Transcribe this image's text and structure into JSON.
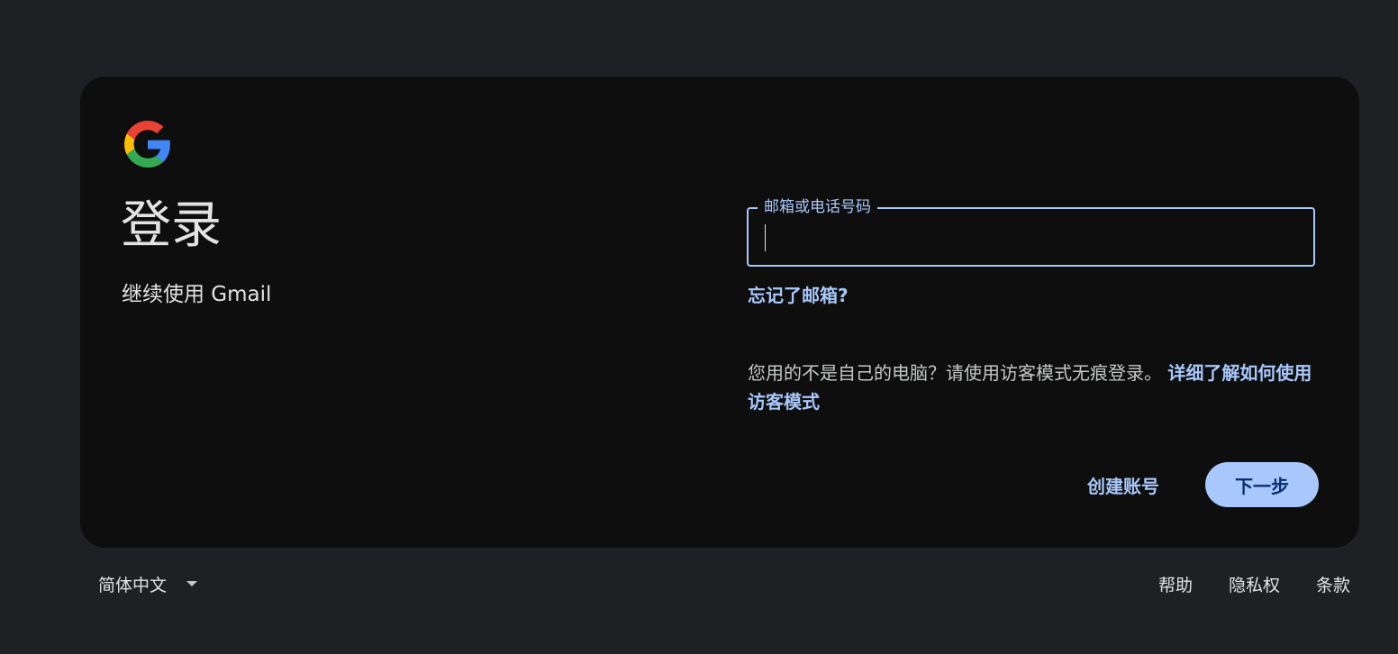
{
  "login": {
    "title": "登录",
    "subtitle": "继续使用 Gmail",
    "email_label": "邮箱或电话号码",
    "email_value": "",
    "forgot_email": "忘记了邮箱?",
    "guest_note": "您用的不是自己的电脑？请使用访客模式无痕登录。",
    "guest_link": "详细了解如何使用访客模式",
    "create_account": "创建账号",
    "next": "下一步"
  },
  "footer": {
    "language": "简体中文",
    "links": [
      "帮助",
      "隐私权",
      "条款"
    ]
  },
  "colors": {
    "page_background": "#1f2023",
    "card_background": "#0e0e0e",
    "accent": "#a8c7fa",
    "button_text": "#062e6f",
    "text_primary": "#e3e3e3",
    "text_secondary": "#c4c7c5"
  },
  "icons": {
    "logo": "google-g-icon",
    "language_dropdown": "caret-down-icon"
  }
}
